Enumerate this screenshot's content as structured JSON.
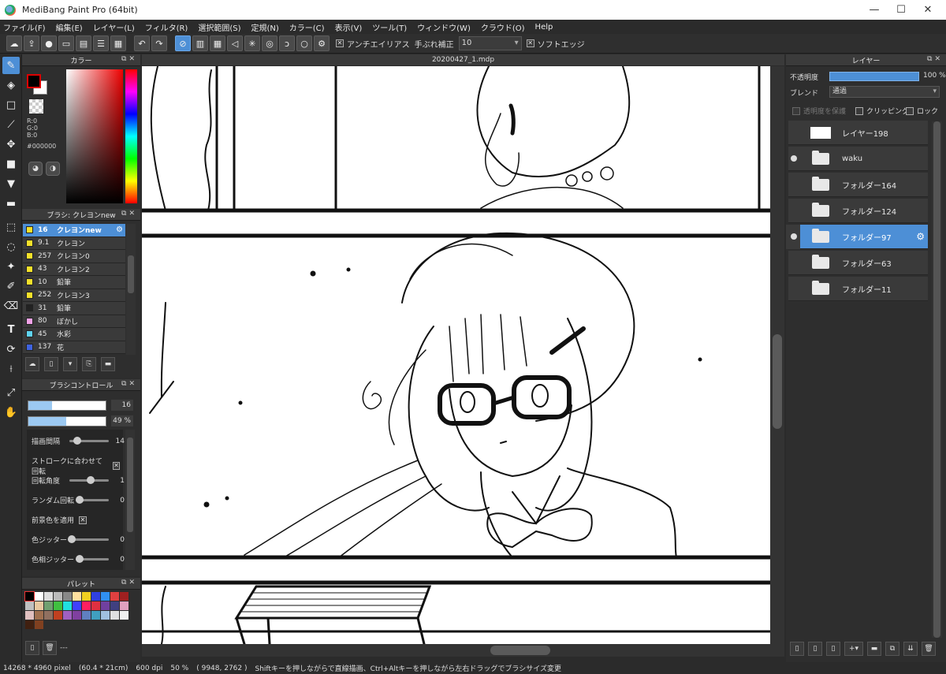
{
  "window": {
    "title": "MediBang Paint Pro (64bit)",
    "controls": [
      "—",
      "☐",
      "✕"
    ]
  },
  "menu": [
    "ファイル(F)",
    "編集(E)",
    "レイヤー(L)",
    "フィルタ(R)",
    "選択範囲(S)",
    "定規(N)",
    "カラー(C)",
    "表示(V)",
    "ツール(T)",
    "ウィンドウ(W)",
    "クラウド(O)",
    "Help"
  ],
  "toolbar": {
    "antialias_label": "アンチエイリアス",
    "antialias_checked": "✕",
    "stabilizer_label": "手ぶれ補正",
    "stabilizer_value": "10",
    "softedge_label": "ソフトエッジ",
    "softedge_checked": "✕"
  },
  "color_panel": {
    "title": "カラー",
    "r": "R:0",
    "g": "G:0",
    "b": "B:0",
    "hex": "#000000",
    "fg_color": "#000000",
    "bg_color": "#ffffff"
  },
  "brush_panel": {
    "title": "ブラシ: クレヨンnew",
    "brushes": [
      {
        "size": "16",
        "name": "クレヨンnew",
        "color": "#f5e12a"
      },
      {
        "size": "9.1",
        "name": "クレヨン",
        "color": "#f5e12a"
      },
      {
        "size": "257",
        "name": "クレヨン0",
        "color": "#f5e12a"
      },
      {
        "size": "43",
        "name": "クレヨン2",
        "color": "#f5e12a"
      },
      {
        "size": "10",
        "name": "鉛筆",
        "color": "#f5e12a"
      },
      {
        "size": "252",
        "name": "クレヨン3",
        "color": "#f5e12a"
      },
      {
        "size": "31",
        "name": "鉛筆",
        "color": "#222222"
      },
      {
        "size": "80",
        "name": "ぼかし",
        "color": "#f2a3e8"
      },
      {
        "size": "45",
        "name": "水彩",
        "color": "#5fd3f0"
      },
      {
        "size": "137",
        "name": "花",
        "color": "#3f63e0"
      }
    ]
  },
  "brush_control": {
    "title": "ブラシコントロール",
    "size_value": "16",
    "size_fraction": 0.31,
    "opacity_value": "49",
    "opacity_unit": "%",
    "opacity_fraction": 0.49,
    "spacing_label": "描画間隔",
    "spacing_value": "14",
    "rotate_stroke_label": "ストロークに合わせて回転",
    "rotate_stroke_checked": "✕",
    "angle_label": "回転角度",
    "angle_value": "1",
    "random_rotate_label": "ランダム回転",
    "random_rotate_value": "0",
    "apply_fg_label": "前景色を適用",
    "apply_fg_checked": "✕",
    "color_jitter_label": "色ジッター",
    "color_jitter_value": "0",
    "hue_jitter_label": "色相ジッター",
    "hue_jitter_value": "0"
  },
  "palette": {
    "title": "パレット",
    "footer_text": "---",
    "colors": [
      "#000000",
      "#ffffff",
      "#dddddd",
      "#bbbbbb",
      "#888888",
      "#ffe0a0",
      "#f0d020",
      "#3040e0",
      "#3090f0",
      "#e04040",
      "#a02020",
      "#c0c0c0",
      "#e8c8a0",
      "#70a070",
      "#40c040",
      "#20e0e0",
      "#4040ff",
      "#ff2060",
      "#e03040",
      "#7040a0",
      "#404080",
      "#e0a0c0",
      "#e0c0c0",
      "#a07050",
      "#907060",
      "#c04020",
      "#a060c0",
      "#8040a0",
      "#6080c0",
      "#40a0c0",
      "#a0c0e0",
      "#e0e0e0",
      "#f0f0f0",
      "#402010",
      "#804020"
    ]
  },
  "document": {
    "tab_name": "20200427_1.mdp"
  },
  "layers_panel": {
    "title": "レイヤー",
    "opacity_label": "不透明度",
    "opacity_value": "100",
    "opacity_unit": "%",
    "opacity_fraction": 1.0,
    "blend_label": "ブレンド",
    "blend_value": "通過",
    "protect_alpha_label": "透明度を保護",
    "clipping_label": "クリッピング",
    "lock_label": "ロック",
    "layers": [
      {
        "name": "レイヤー198",
        "type": "layer",
        "visible": false,
        "selected": false
      },
      {
        "name": "waku",
        "type": "folder",
        "visible": true,
        "selected": false
      },
      {
        "name": "フォルダー164",
        "type": "folder",
        "visible": false,
        "selected": false
      },
      {
        "name": "フォルダー124",
        "type": "folder",
        "visible": false,
        "selected": false
      },
      {
        "name": "フォルダー97",
        "type": "folder",
        "visible": true,
        "selected": true
      },
      {
        "name": "フォルダー63",
        "type": "folder",
        "visible": false,
        "selected": false
      },
      {
        "name": "フォルダー11",
        "type": "folder",
        "visible": false,
        "selected": false
      }
    ]
  },
  "status": {
    "dimensions": "14268 * 4960 pixel",
    "size_cm": "(60.4 * 21cm)",
    "dpi": "600 dpi",
    "zoom": "50 %",
    "coords": "( 9948, 2762 )",
    "hint": "Shiftキーを押しながらで直線描画、Ctrl+Altキーを押しながら左右ドラッグでブラシサイズ変更"
  }
}
